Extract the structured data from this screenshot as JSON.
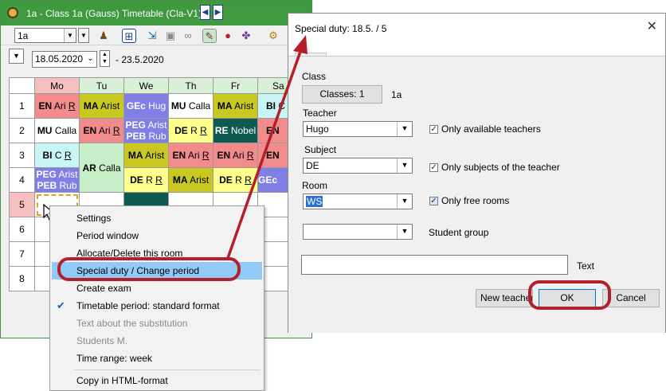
{
  "timetable": {
    "title": "1a - Class 1a (Gauss)  Timetable  (Cla-V1)",
    "nav_prev": "◀",
    "nav_next": "▶",
    "class_select": "1a",
    "date_from": "18.05.2020",
    "date_to": "- 23.5.2020",
    "days": [
      "Mo",
      "Tu",
      "We",
      "Th",
      "Fr",
      "Sa"
    ],
    "periods": [
      "1",
      "2",
      "3",
      "4",
      "5",
      "6",
      "7",
      "8"
    ],
    "cells": {
      "mo1": {
        "a": "EN",
        "b": "Ari",
        "c": "R"
      },
      "tu1": {
        "a": "MA",
        "b": "Arist",
        "c": ""
      },
      "we1": {
        "a": "GEc",
        "b": "Hug",
        "c": ""
      },
      "th1": {
        "a": "MU",
        "b": "Calla",
        "c": ""
      },
      "fr1": {
        "a": "MA",
        "b": "Arist",
        "c": ""
      },
      "sa1": {
        "a": "BI",
        "b": "C",
        "c": ""
      },
      "mo2": {
        "a": "MU",
        "b": "Calla",
        "c": ""
      },
      "tu2": {
        "a": "EN",
        "b": "Ari",
        "c": "R"
      },
      "we2a": {
        "a": "PEG",
        "b": "Arist",
        "c": ""
      },
      "we2b": {
        "a": "PEB",
        "b": "Rub",
        "c": ""
      },
      "th2": {
        "a": "DE",
        "b": "R",
        "c": "R"
      },
      "fr2": {
        "a": "RE",
        "b": "Nobel",
        "c": ""
      },
      "sa2": {
        "a": "EN",
        "b": "",
        "c": ""
      },
      "mo3": {
        "a": "BI",
        "b": "C",
        "c": "R"
      },
      "tu34": {
        "a": "AR",
        "b": "Calla",
        "c": ""
      },
      "we3": {
        "a": "MA",
        "b": "Arist",
        "c": ""
      },
      "th3": {
        "a": "EN",
        "b": "Ari",
        "c": "R"
      },
      "fr3": {
        "a": "EN",
        "b": "Ari",
        "c": "R"
      },
      "sa3": {
        "a": "EN",
        "b": "",
        "c": ""
      },
      "mo4a": {
        "a": "PEG",
        "b": "Arist",
        "c": ""
      },
      "mo4b": {
        "a": "PEB",
        "b": "Rub",
        "c": ""
      },
      "we4": {
        "a": "DE",
        "b": "R",
        "c": "R"
      },
      "th4": {
        "a": "MA",
        "b": "Arist",
        "c": ""
      },
      "fr4": {
        "a": "DE",
        "b": "R",
        "c": "R"
      },
      "sa4": {
        "a": "GEc",
        "b": "",
        "c": ""
      }
    }
  },
  "context_menu": {
    "items": [
      {
        "label": "Settings",
        "disabled": false,
        "checked": false,
        "highlight": false
      },
      {
        "label": "Period window",
        "disabled": false,
        "checked": false,
        "highlight": false
      },
      {
        "label": "Allocate/Delete this room",
        "disabled": false,
        "checked": false,
        "highlight": false
      },
      {
        "label": "Special duty / Change period",
        "disabled": false,
        "checked": false,
        "highlight": true
      },
      {
        "label": "Create exam",
        "disabled": false,
        "checked": false,
        "highlight": false
      },
      {
        "label": "Timetable period: standard format",
        "disabled": false,
        "checked": true,
        "highlight": false
      },
      {
        "label": "Text about the substitution",
        "disabled": true,
        "checked": false,
        "highlight": false
      },
      {
        "label": "Students M.",
        "disabled": true,
        "checked": false,
        "highlight": false
      },
      {
        "label": "Time range: week",
        "disabled": false,
        "checked": false,
        "highlight": false
      },
      {
        "label": "Copy in HTML-format",
        "disabled": false,
        "checked": false,
        "highlight": false
      }
    ]
  },
  "dialog": {
    "title": "Special duty:  18.5. / 5",
    "close": "✕",
    "class_label": "Class",
    "classes_button": "Classes: 1",
    "class_value": "1a",
    "teacher_label": "Teacher",
    "teacher_value": "Hugo",
    "only_available_teachers": "Only available teachers",
    "subject_label": "Subject",
    "subject_value": "DE",
    "only_subjects_of_teacher": "Only subjects of the teacher",
    "room_label": "Room",
    "room_value": "WS",
    "only_free_rooms": "Only free rooms",
    "student_group_label": "Student group",
    "text_label": "Text",
    "new_teacher_button": "New teacher",
    "ok_button": "OK",
    "cancel_button": "Cancel"
  },
  "colors": {
    "titlebar_green": "#3f9a3f",
    "lesson_red": "#f28b8b",
    "lesson_olive": "#c8c820",
    "lesson_purple": "#7f7fe6",
    "lesson_teal": "#0f5a50",
    "lesson_yellow": "#ffff8c",
    "lesson_green": "#c8f0c8",
    "lesson_cyan": "#c8f5f5",
    "lesson_pink": "#f5c0d8",
    "menu_highlight": "#91c9f7",
    "annotation_red": "#b4202a"
  }
}
